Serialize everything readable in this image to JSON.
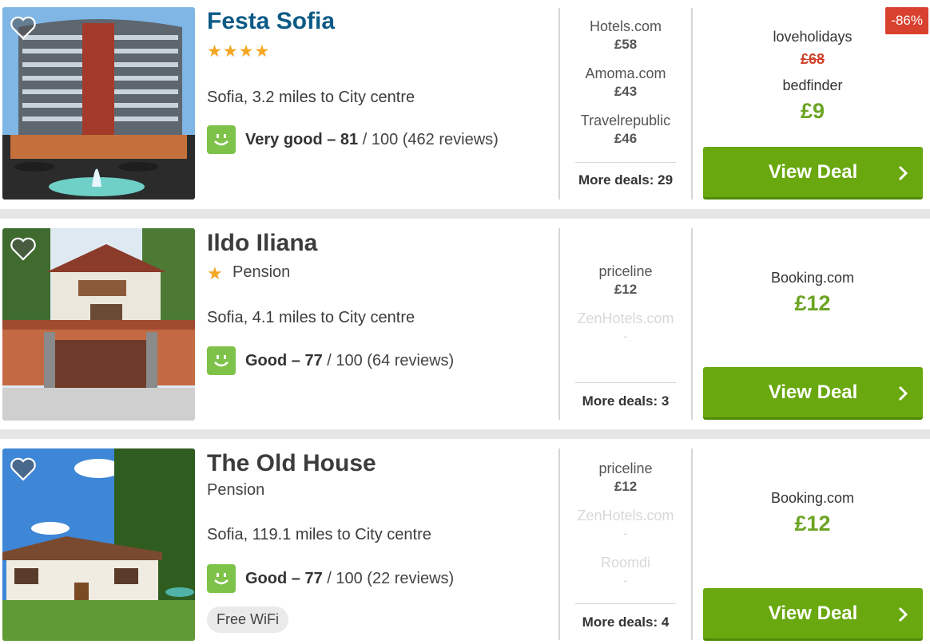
{
  "hotels": [
    {
      "name": "Festa Sofia",
      "stars": "★★★★",
      "type": "",
      "location": "Sofia, 3.2 miles to City centre",
      "rating_word": "Very good – 81",
      "rating_rest": " / 100 (462 reviews)",
      "deals": [
        {
          "provider": "Hotels.com",
          "price": "£58"
        },
        {
          "provider": "Amoma.com",
          "price": "£43"
        },
        {
          "provider": "Travelrepublic",
          "price": "£46"
        }
      ],
      "more_deals": "More deals: 29",
      "discount": "-86%",
      "old_provider": "loveholidays",
      "old_price": "£68",
      "best_provider": "bedfinder",
      "best_price": "£9",
      "cta": "View Deal"
    },
    {
      "name": "Ildo Iliana",
      "stars": "★",
      "type": "Pension",
      "location": "Sofia, 4.1 miles to City centre",
      "rating_word": "Good – 77",
      "rating_rest": " / 100 (64 reviews)",
      "deals": [
        {
          "provider": "priceline",
          "price": "£12"
        },
        {
          "provider": "ZenHotels.com",
          "price": "-"
        }
      ],
      "more_deals": "More deals: 3",
      "best_provider": "Booking.com",
      "best_price": "£12",
      "cta": "View Deal"
    },
    {
      "name": "The Old House",
      "stars": "",
      "type": "Pension",
      "location": "Sofia, 119.1 miles to City centre",
      "rating_word": "Good – 77",
      "rating_rest": " / 100 (22 reviews)",
      "amenity": "Free WiFi",
      "deals": [
        {
          "provider": "priceline",
          "price": "£12"
        },
        {
          "provider": "ZenHotels.com",
          "price": "-"
        },
        {
          "provider": "Roomdi",
          "price": "-"
        }
      ],
      "more_deals": "More deals: 4",
      "best_provider": "Booking.com",
      "best_price": "£12",
      "cta": "View Deal"
    }
  ],
  "colors": {
    "title_link": "#0c5a86",
    "price_green": "#6ca424",
    "button_green": "#69a80e",
    "discount_red": "#d9412f",
    "rating_green": "#7ec24a",
    "star": "#f5a623"
  },
  "icons": {
    "favorite": "heart-icon",
    "rating": "smiley-icon",
    "cta": "chevron-right-icon"
  }
}
